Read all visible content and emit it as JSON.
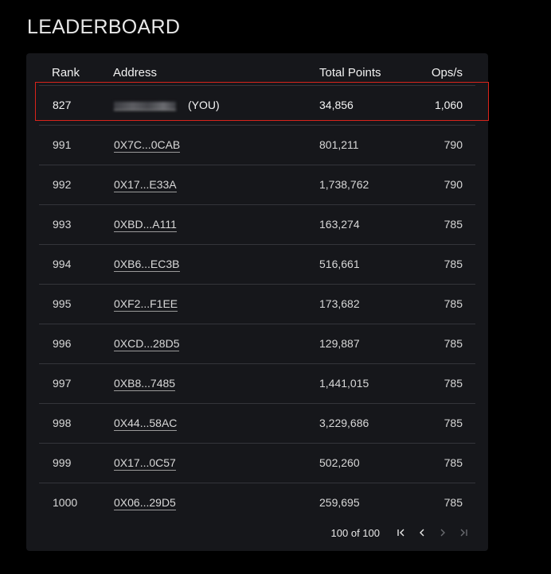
{
  "title": "LEADERBOARD",
  "columns": {
    "rank": "Rank",
    "address": "Address",
    "points": "Total Points",
    "ops": "Ops/s"
  },
  "you_row": {
    "rank": "827",
    "you_label": "(YOU)",
    "points": "34,856",
    "ops": "1,060"
  },
  "rows": [
    {
      "rank": "991",
      "address": "0X7C...0CAB",
      "points": "801,211",
      "ops": "790"
    },
    {
      "rank": "992",
      "address": "0X17...E33A",
      "points": "1,738,762",
      "ops": "790"
    },
    {
      "rank": "993",
      "address": "0XBD...A111",
      "points": "163,274",
      "ops": "785"
    },
    {
      "rank": "994",
      "address": "0XB6...EC3B",
      "points": "516,661",
      "ops": "785"
    },
    {
      "rank": "995",
      "address": "0XF2...F1EE",
      "points": "173,682",
      "ops": "785"
    },
    {
      "rank": "996",
      "address": "0XCD...28D5",
      "points": "129,887",
      "ops": "785"
    },
    {
      "rank": "997",
      "address": "0XB8...7485",
      "points": "1,441,015",
      "ops": "785"
    },
    {
      "rank": "998",
      "address": "0X44...58AC",
      "points": "3,229,686",
      "ops": "785"
    },
    {
      "rank": "999",
      "address": "0X17...0C57",
      "points": "502,260",
      "ops": "785"
    },
    {
      "rank": "1000",
      "address": "0X06...29D5",
      "points": "259,695",
      "ops": "785"
    }
  ],
  "pagination": {
    "count": "100 of 100"
  },
  "colors": {
    "highlight": "#d9241b",
    "card_bg": "#16171b"
  }
}
